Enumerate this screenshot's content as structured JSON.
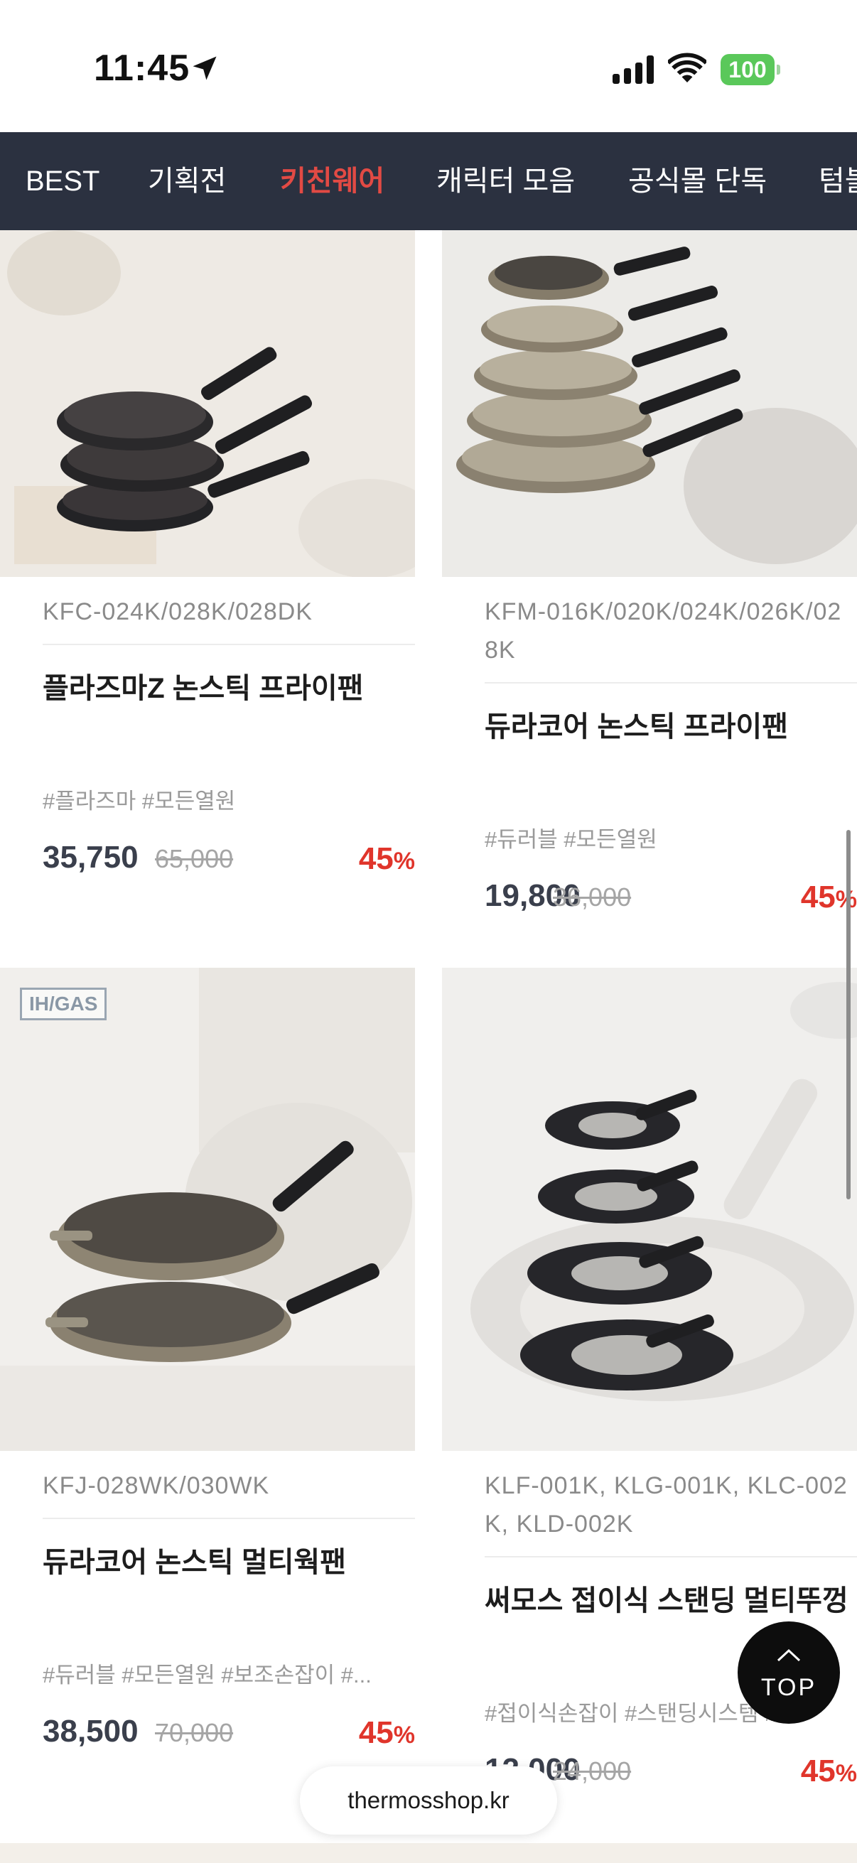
{
  "status_bar": {
    "time": "11:45",
    "battery": "100",
    "icons": [
      "location-arrow-icon",
      "cellular-signal-icon",
      "wifi-icon",
      "battery-icon"
    ]
  },
  "nav": {
    "tabs": [
      {
        "label": "BEST",
        "active": false
      },
      {
        "label": "기획전",
        "active": false
      },
      {
        "label": "키친웨어",
        "active": true
      },
      {
        "label": "캐릭터 모음",
        "active": false
      },
      {
        "label": "공식몰 단독",
        "active": false
      },
      {
        "label": "텀블",
        "active": false
      }
    ],
    "active_color": "#e24a44",
    "background": "#2b3140"
  },
  "products": [
    {
      "model": "KFC-024K/028K/028DK",
      "name": "플라즈마Z 논스틱 프라이팬",
      "tags": "#플라즈마 #모든열원",
      "price": "35,750",
      "original_price": "65,000",
      "discount": "45",
      "discount_unit": "%"
    },
    {
      "model": "KFM-016K/020K/024K/026K/028K",
      "name": "듀라코어 논스틱 프라이팬",
      "tags": "#듀러블 #모든열원",
      "price": "19,800",
      "original_price": "36,000",
      "discount": "45",
      "discount_unit": "%"
    },
    {
      "badge": "IH/GAS",
      "model": "KFJ-028WK/030WK",
      "name": "듀라코어 논스틱 멀티웍팬",
      "tags": "#듀러블 #모든열원 #보조손잡이 #...",
      "price": "38,500",
      "original_price": "70,000",
      "discount": "45",
      "discount_unit": "%"
    },
    {
      "model": "KLF-001K, KLG-001K, KLC-002K, KLD-002K",
      "name": "써모스 접이식 스탠딩 멀티뚜껑",
      "tags": "#접이식손잡이 #스탠딩시스템 #...",
      "price": "12,000",
      "original_price": "24,000",
      "discount": "45",
      "discount_unit": "%"
    }
  ],
  "top_button": {
    "label": "TOP"
  },
  "url_bar": {
    "domain": "thermosshop.kr"
  },
  "colors": {
    "discount": "#e0352b",
    "price": "#3a3f4c",
    "nav_bg": "#2b3140"
  }
}
